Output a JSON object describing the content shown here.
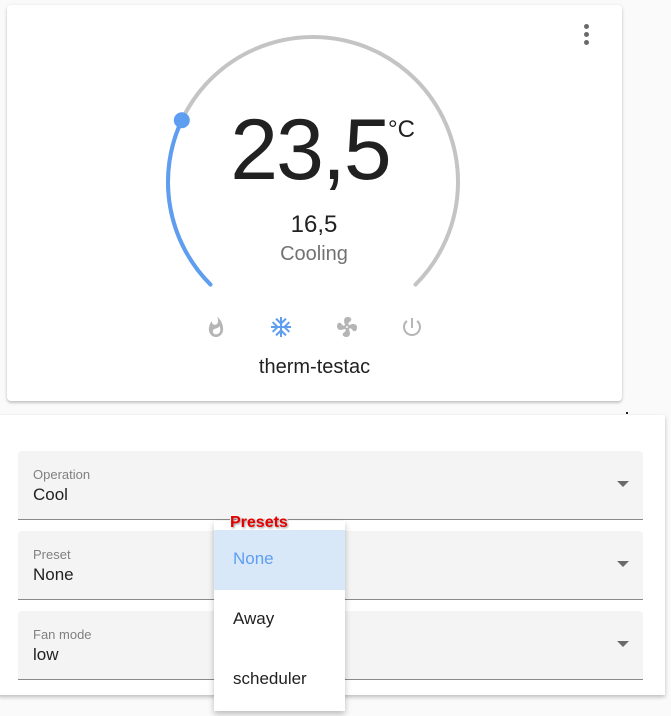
{
  "card": {
    "menu_icon": "more-vertical-icon",
    "current_temperature": "23,5",
    "unit": "°C",
    "target_temperature": "16,5",
    "hvac_action": "Cooling",
    "dial_fraction": 0.26,
    "colors": {
      "track": "#c4c4c4",
      "active": "#5d9ef0",
      "mode_inactive": "#b5b5b5"
    },
    "modes": [
      {
        "name": "heat",
        "icon": "flame-icon",
        "active": false
      },
      {
        "name": "cool",
        "icon": "snowflake-icon",
        "active": true
      },
      {
        "name": "fan_only",
        "icon": "fan-icon",
        "active": false
      },
      {
        "name": "off",
        "icon": "power-icon",
        "active": false
      }
    ],
    "entity_name": "therm-testac"
  },
  "panel": {
    "fields": [
      {
        "label": "Operation",
        "value": "Cool"
      },
      {
        "label": "Preset",
        "value": "None"
      },
      {
        "label": "Fan mode",
        "value": "low"
      }
    ]
  },
  "dropdown": {
    "annotation": "Presets",
    "options": [
      {
        "label": "None",
        "selected": true
      },
      {
        "label": "Away",
        "selected": false
      },
      {
        "label": "scheduler",
        "selected": false
      }
    ]
  }
}
